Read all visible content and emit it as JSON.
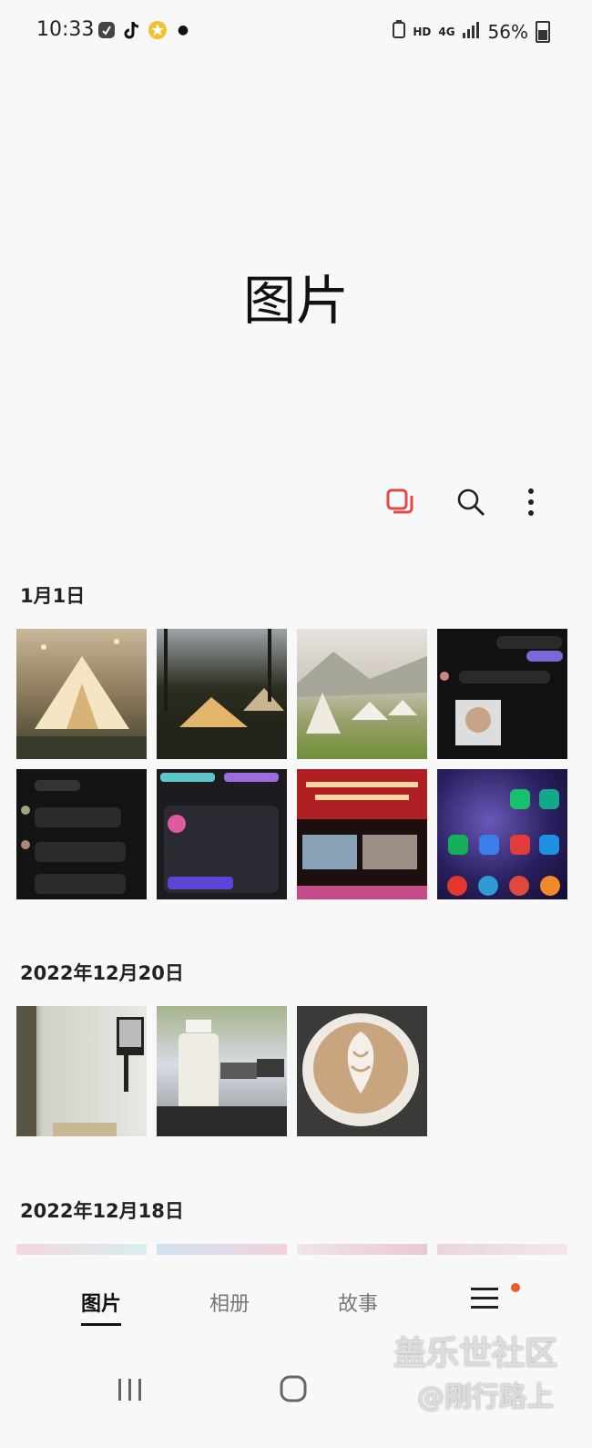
{
  "status": {
    "time": "10:33",
    "hd": "HD",
    "network": "4G",
    "battery": "56%"
  },
  "header": {
    "title": "图片"
  },
  "toolbar": {
    "icons": [
      "select-copy-icon",
      "search-icon",
      "more-vertical-icon"
    ],
    "accent": "#e04a4a"
  },
  "sections": [
    {
      "date": "1月1日",
      "thumbs": 8
    },
    {
      "date": "2022年12月20日",
      "thumbs": 3
    },
    {
      "date": "2022年12月18日",
      "thumbs": 4
    }
  ],
  "tabs": {
    "photos": "图片",
    "albums": "相册",
    "stories": "故事",
    "menu_icon": "hamburger-menu-icon",
    "badge_color": "#ee5a2a"
  },
  "watermark": {
    "line1": "盖乐世社区",
    "line2": "@刚行路上"
  }
}
